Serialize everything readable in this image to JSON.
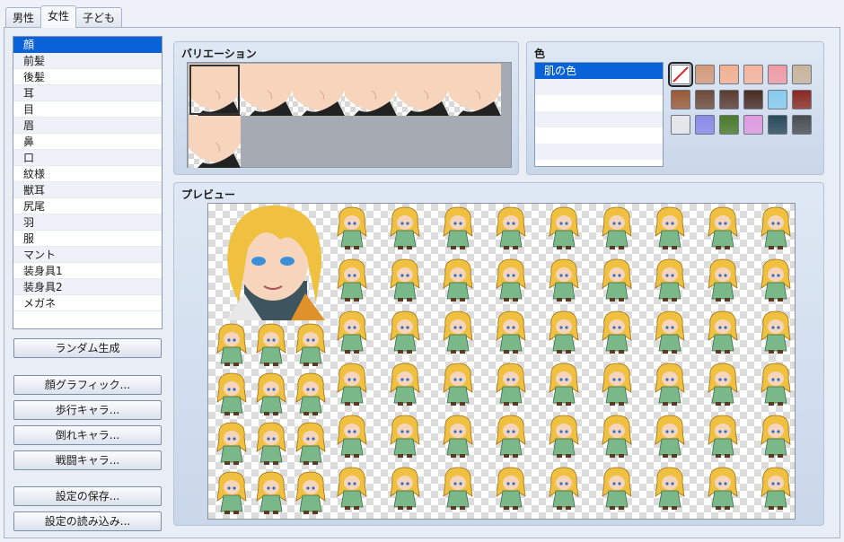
{
  "tabs": [
    {
      "label": "男性",
      "active": false
    },
    {
      "label": "女性",
      "active": true
    },
    {
      "label": "子ども",
      "active": false
    }
  ],
  "parts": [
    "顔",
    "前髪",
    "後髪",
    "耳",
    "目",
    "眉",
    "鼻",
    "口",
    "紋様",
    "獣耳",
    "尻尾",
    "羽",
    "服",
    "マント",
    "装身具1",
    "装身具2",
    "メガネ"
  ],
  "selected_part_index": 0,
  "buttons": {
    "random": "ランダム生成",
    "face": "顔グラフィック...",
    "walk": "歩行キャラ...",
    "down": "倒れキャラ...",
    "battle": "戦闘キャラ...",
    "save": "設定の保存...",
    "load": "設定の読み込み..."
  },
  "variation": {
    "title": "バリエーション",
    "count": 7,
    "selected_index": 0
  },
  "color": {
    "title": "色",
    "items": [
      "肌の色",
      "",
      "",
      "",
      "",
      ""
    ],
    "selected_index": 0,
    "swatches": [
      "none",
      "#d49a78",
      "#f4b090",
      "#f6b49c",
      "#f09aa4",
      "#c8b49a",
      "#9a5a36",
      "#6e4a3a",
      "#5a3c30",
      "#4a2c22",
      "#88ccee",
      "#8a2a22",
      "#e8e8ea",
      "#8a8ae8",
      "#4a7a2a",
      "#e09ae0",
      "#2a4a5a",
      "#4a4e52"
    ],
    "selected_swatch": 0
  },
  "preview": {
    "title": "プレビュー",
    "hair_color": "#f0c040",
    "outfit_color": "#7ab88a"
  }
}
